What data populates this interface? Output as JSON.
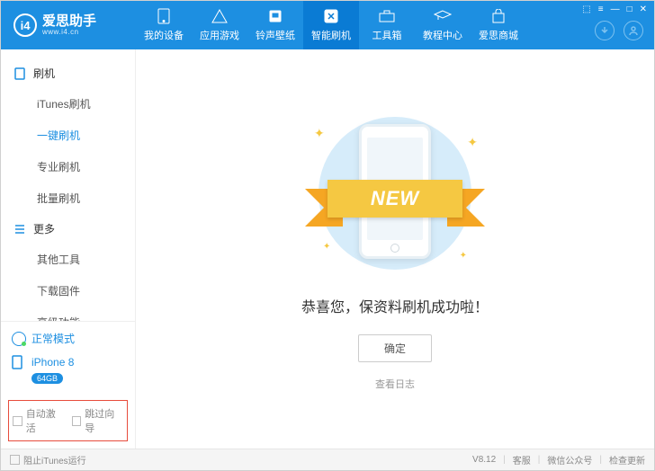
{
  "app": {
    "name": "爱思助手",
    "url": "www.i4.cn",
    "logo_text": "i4"
  },
  "window_controls": [
    "⬚",
    "≡",
    "—",
    "□",
    "✕"
  ],
  "nav": [
    {
      "id": "device",
      "label": "我的设备"
    },
    {
      "id": "apps",
      "label": "应用游戏"
    },
    {
      "id": "ringtone",
      "label": "铃声壁纸"
    },
    {
      "id": "flash",
      "label": "智能刷机",
      "active": true
    },
    {
      "id": "toolbox",
      "label": "工具箱"
    },
    {
      "id": "tutorial",
      "label": "教程中心"
    },
    {
      "id": "mall",
      "label": "爱思商城"
    }
  ],
  "sidebar": {
    "groups": [
      {
        "title": "刷机",
        "icon": "phone",
        "items": [
          {
            "label": "iTunes刷机"
          },
          {
            "label": "一键刷机",
            "active": true
          },
          {
            "label": "专业刷机"
          },
          {
            "label": "批量刷机"
          }
        ]
      },
      {
        "title": "更多",
        "icon": "menu",
        "items": [
          {
            "label": "其他工具"
          },
          {
            "label": "下载固件"
          },
          {
            "label": "高级功能"
          }
        ]
      }
    ],
    "mode": "正常模式",
    "device": {
      "name": "iPhone 8",
      "storage": "64GB"
    },
    "check_auto": "自动激活",
    "check_skip": "跳过向导"
  },
  "main": {
    "ribbon": "NEW",
    "message": "恭喜您，保资料刷机成功啦！",
    "ok": "确定",
    "log": "查看日志"
  },
  "footer": {
    "block_itunes": "阻止iTunes运行",
    "version": "V8.12",
    "support": "客服",
    "wechat": "微信公众号",
    "update": "检查更新"
  }
}
